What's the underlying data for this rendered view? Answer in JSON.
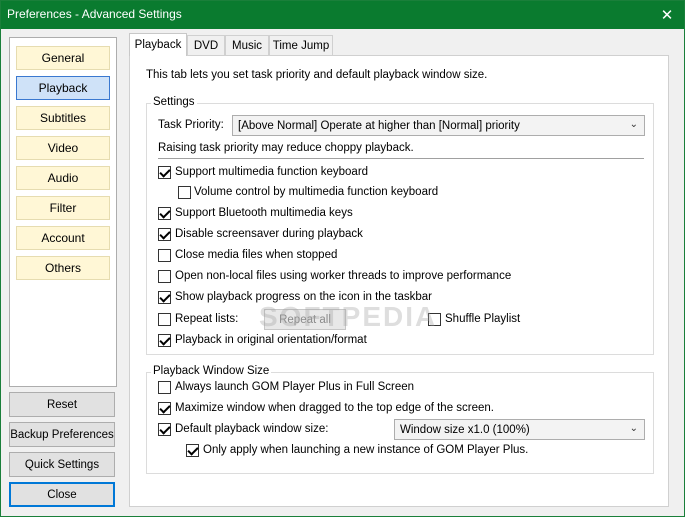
{
  "window": {
    "title": "Preferences - Advanced Settings",
    "close_glyph": "✕"
  },
  "nav": {
    "items": [
      "General",
      "Playback",
      "Subtitles",
      "Video",
      "Audio",
      "Filter",
      "Account",
      "Others"
    ],
    "active": "Playback"
  },
  "side_buttons": {
    "reset": "Reset",
    "backup": "Backup Preferences",
    "quick": "Quick Settings",
    "close": "Close"
  },
  "tabs": [
    "Playback",
    "DVD",
    "Music",
    "Time Jump"
  ],
  "content": {
    "intro": "This tab lets you set task priority and default playback window size.",
    "settings_group": "Settings",
    "task_priority_label": "Task Priority:",
    "task_priority_value": "[Above Normal] Operate at higher than [Normal] priority",
    "priority_note": "Raising task priority may reduce choppy playback.",
    "options": [
      {
        "label": "Support multimedia function keyboard",
        "checked": true
      },
      {
        "label": "Volume control by multimedia function keyboard",
        "checked": false
      },
      {
        "label": "Support Bluetooth multimedia keys",
        "checked": true
      },
      {
        "label": "Disable screensaver during playback",
        "checked": true
      },
      {
        "label": "Close media files when stopped",
        "checked": false
      },
      {
        "label": "Open non-local files using worker threads to improve performance",
        "checked": false
      },
      {
        "label": "Show playback progress on the icon in the taskbar",
        "checked": true
      },
      {
        "label": "Repeat lists:",
        "checked": false
      },
      {
        "label": "Playback in original orientation/format",
        "checked": true
      }
    ],
    "repeat_button": "Repeat all",
    "shuffle_label": "Shuffle Playlist",
    "shuffle_checked": false,
    "window_group": "Playback Window Size",
    "window_options": [
      {
        "label": "Always launch GOM Player Plus in Full Screen",
        "checked": false
      },
      {
        "label": "Maximize window when dragged to the top edge of the screen.",
        "checked": true
      },
      {
        "label": "Default playback window size:",
        "checked": true
      },
      {
        "label": "Only apply when launching a new instance of GOM Player Plus.",
        "checked": true
      }
    ],
    "window_size_value": "Window size x1.0 (100%)",
    "chevron": "⌄"
  },
  "watermark": "SOFTPEDIA"
}
